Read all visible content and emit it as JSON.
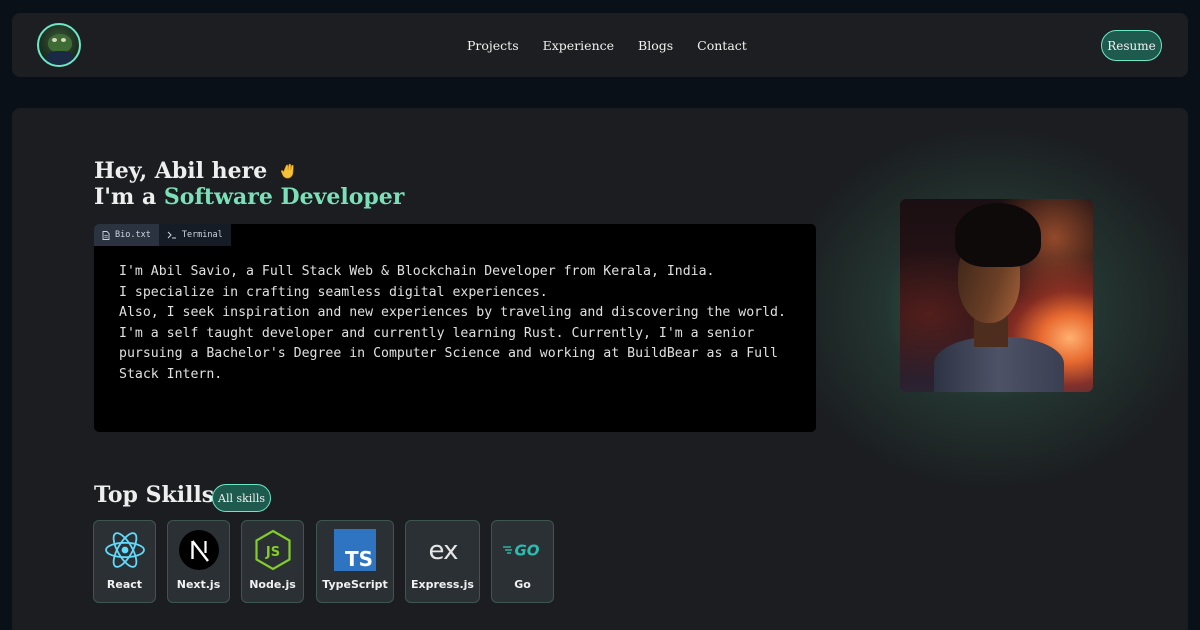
{
  "nav": {
    "links": [
      "Projects",
      "Experience",
      "Blogs",
      "Contact"
    ],
    "resume_label": "Resume"
  },
  "hero": {
    "greeting": "Hey, Abil here",
    "role_prefix": "I'm a",
    "role": "Software Developer"
  },
  "terminal": {
    "tabs": [
      {
        "label": "Bio.txt",
        "icon": "file-icon"
      },
      {
        "label": "Terminal",
        "icon": "terminal-icon"
      }
    ],
    "bio": "I'm Abil Savio, a Full Stack Web & Blockchain Developer from Kerala, India.\nI specialize in crafting seamless digital experiences.\nAlso, I seek inspiration and new experiences by traveling and discovering the world.\nI'm a self taught developer and currently learning Rust. Currently, I'm a senior\npursuing a Bachelor's Degree in Computer Science and working at BuildBear as a Full\nStack Intern."
  },
  "skills": {
    "title": "Top Skills",
    "all_label": "All skills",
    "items": [
      {
        "label": "React",
        "icon": "react-icon"
      },
      {
        "label": "Next.js",
        "icon": "nextjs-icon"
      },
      {
        "label": "Node.js",
        "icon": "nodejs-icon"
      },
      {
        "label": "TypeScript",
        "icon": "typescript-icon"
      },
      {
        "label": "Express.js",
        "icon": "express-icon"
      },
      {
        "label": "Go",
        "icon": "go-icon"
      }
    ]
  },
  "colors": {
    "accent": "#7be0b8",
    "button_bg": "#1e5a4e",
    "button_border": "#6ee7c6"
  }
}
